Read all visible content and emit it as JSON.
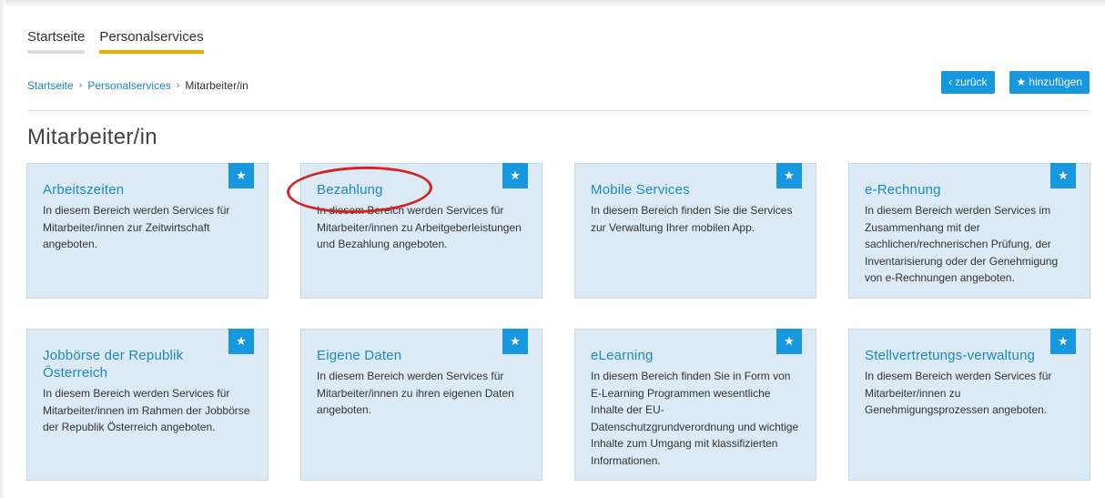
{
  "top_tabs": [
    {
      "label": "Startseite",
      "active": false
    },
    {
      "label": "Personalservices",
      "active": true
    }
  ],
  "breadcrumb": {
    "items": [
      "Startseite",
      "Personalservices"
    ],
    "current": "Mitarbeiter/in",
    "separator": "›"
  },
  "actions": {
    "back_label": "zurück",
    "back_icon": "‹",
    "add_label": "hinzufügen",
    "add_icon": "★"
  },
  "page_title": "Mitarbeiter/in",
  "favorite_icon": "★",
  "cards": [
    {
      "title": "Arbeitszeiten",
      "desc": "In diesem Bereich werden Services für Mitarbeiter/innen zur Zeitwirtschaft angeboten."
    },
    {
      "title": "Bezahlung",
      "desc": "In diesem Bereich werden Services für Mitarbeiter/innen zu Arbeitgeberleistungen und Bezahlung angeboten."
    },
    {
      "title": "Mobile Services",
      "desc": "In diesem Bereich finden Sie die Services zur Verwaltung Ihrer mobilen App."
    },
    {
      "title": "e-Rechnung",
      "desc": "In diesem Bereich werden Services im Zusammenhang mit der sachlichen/rechnerischen Prüfung, der Inventarisierung oder der Genehmigung von e-Rechnungen angeboten."
    },
    {
      "title": "Jobbörse der Republik Österreich",
      "desc": "In diesem Bereich werden Services für Mitarbeiter/innen im Rahmen der Jobbörse der Republik Österreich angeboten."
    },
    {
      "title": "Eigene Daten",
      "desc": "In diesem Bereich werden Services für Mitarbeiter/innen zu ihren eigenen Daten angeboten."
    },
    {
      "title": "eLearning",
      "desc": "In diesem Bereich finden Sie in Form von E-Learning Programmen wesentliche Inhalte der EU-Datenschutzgrundverordnung und wichtige Inhalte zum Umgang mit klassifizierten Informationen."
    },
    {
      "title": "Stellvertretungs-verwaltung",
      "desc": "In diesem Bereich werden Services für Mitarbeiter/innen zu Genehmigungsprozessen angeboten."
    }
  ],
  "colors": {
    "accent": "#1797dd",
    "link": "#1b88c4",
    "card_bg": "#dbeaf5",
    "active_tab": "#f0ad00",
    "annotation": "#d22424"
  }
}
